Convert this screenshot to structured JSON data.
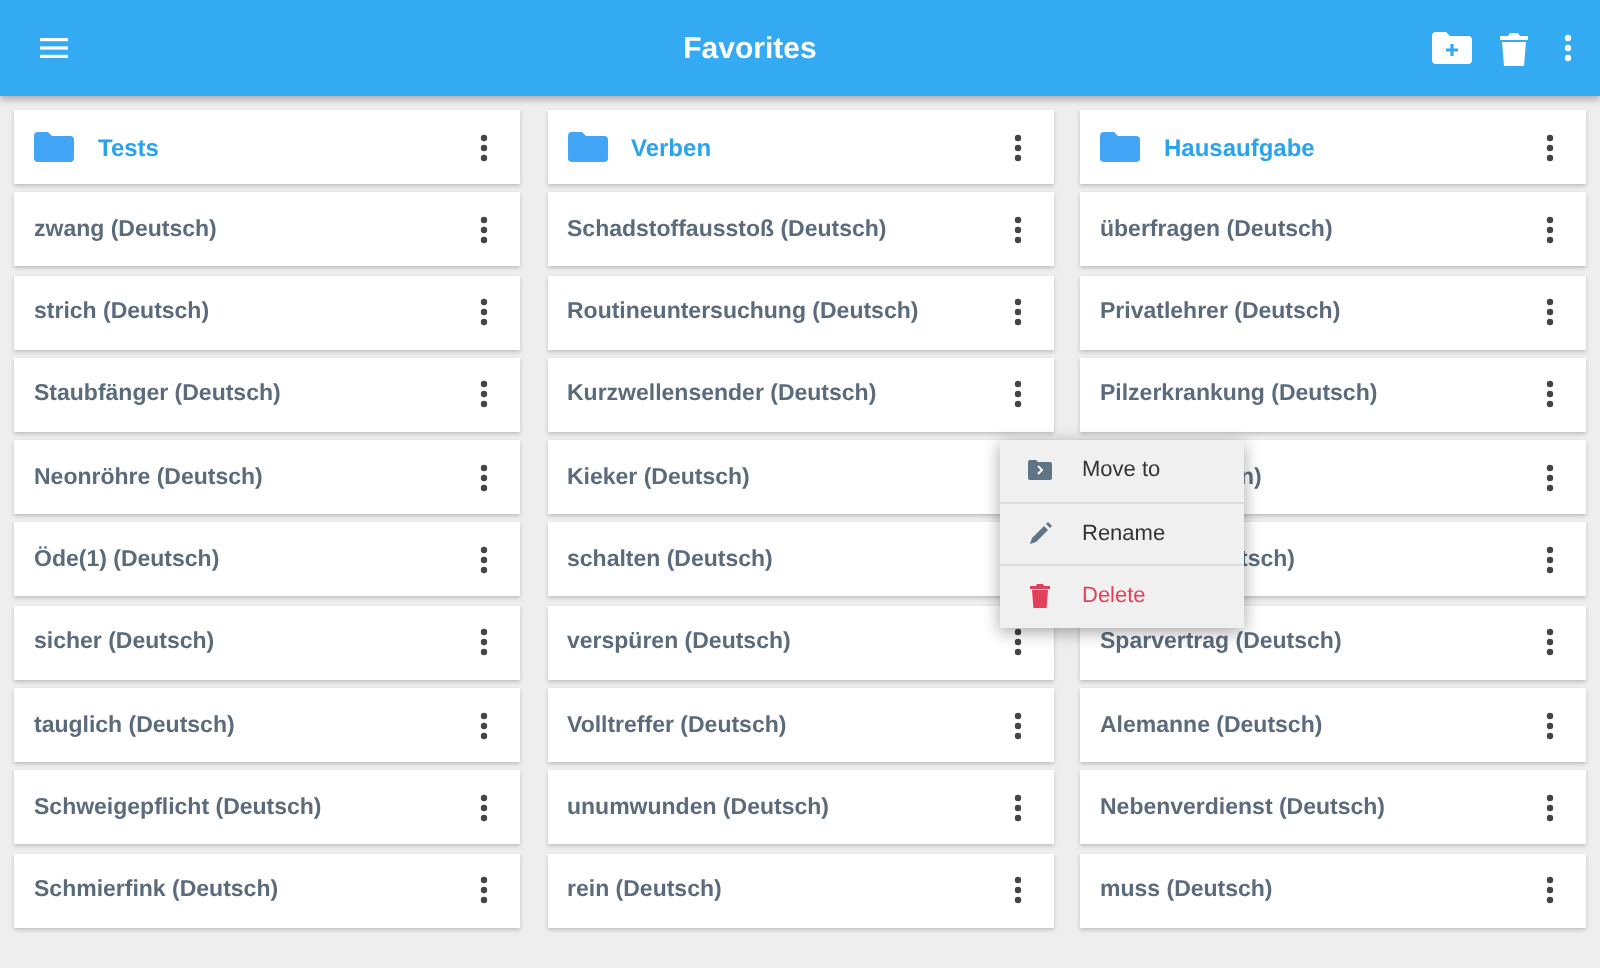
{
  "app_bar": {
    "title": "Favorites"
  },
  "columns": [
    {
      "folder": "Tests",
      "items": [
        {
          "text": "zwang (Deutsch)"
        },
        {
          "text": "strich (Deutsch)"
        },
        {
          "text": "Staubfänger (Deutsch)"
        },
        {
          "text": "Neonröhre (Deutsch)"
        },
        {
          "text": "Öde(1) (Deutsch)"
        },
        {
          "text": "sicher (Deutsch)"
        },
        {
          "text": "tauglich (Deutsch)"
        },
        {
          "text": "Schweigepflicht (Deutsch)"
        },
        {
          "text": "Schmierfink (Deutsch)"
        }
      ]
    },
    {
      "folder": "Verben",
      "items": [
        {
          "text": "Schadstoffausstoß (Deutsch)"
        },
        {
          "text": "Routineuntersuchung (Deutsch)"
        },
        {
          "text": "Kurzwellensender (Deutsch)"
        },
        {
          "text": "Kieker (Deutsch)"
        },
        {
          "text": "schalten (Deutsch)"
        },
        {
          "text": "verspüren (Deutsch)"
        },
        {
          "text": "Volltreffer (Deutsch)"
        },
        {
          "text": "unumwunden (Deutsch)"
        },
        {
          "text": "rein (Deutsch)"
        }
      ]
    },
    {
      "folder": "Hausaufgabe",
      "items": [
        {
          "text": "überfragen (Deutsch)"
        },
        {
          "text": "Privatlehrer (Deutsch)"
        },
        {
          "text": "Pilzerkrankung (Deutsch)"
        },
        {
          "text": "n)",
          "covered": true
        },
        {
          "text": "tsch)",
          "covered": true
        },
        {
          "text": "Sparvertrag (Deutsch)"
        },
        {
          "text": "Alemanne (Deutsch)"
        },
        {
          "text": "Nebenverdienst (Deutsch)"
        },
        {
          "text": "muss (Deutsch)"
        }
      ]
    }
  ],
  "context_menu": [
    {
      "kind": "move",
      "label": "Move to"
    },
    {
      "kind": "rename",
      "label": "Rename"
    },
    {
      "kind": "delete",
      "label": "Delete"
    }
  ]
}
